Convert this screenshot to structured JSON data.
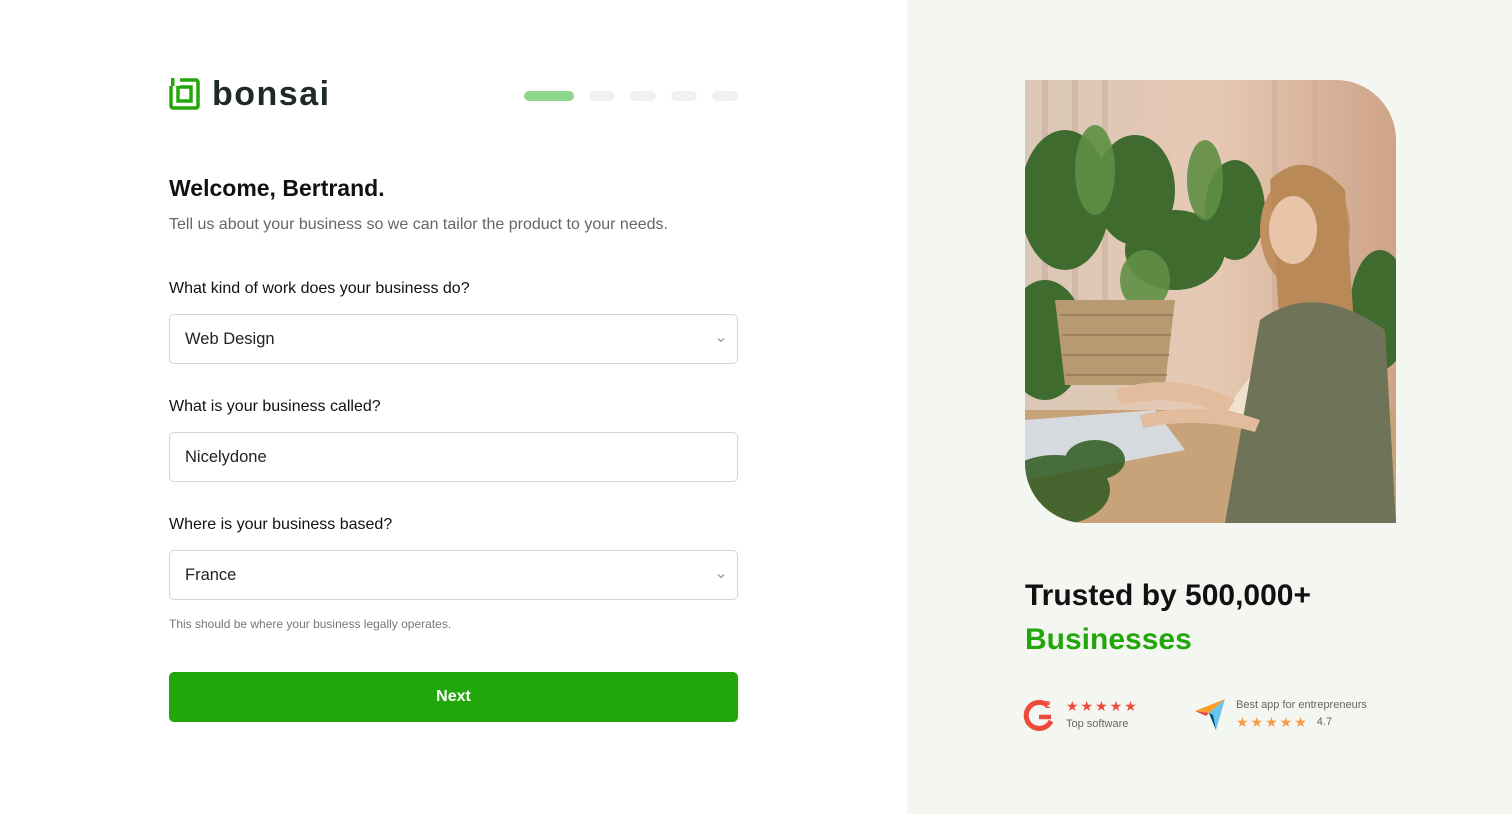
{
  "brand": {
    "name": "bonsai",
    "color": "#22a70b"
  },
  "progress": {
    "total_steps": 5,
    "current_step": 1
  },
  "header": {
    "title": "Welcome, Bertrand.",
    "subtitle": "Tell us about your business so we can tailor the product to your needs."
  },
  "form": {
    "work_type": {
      "label": "What kind of work does your business do?",
      "value": "Web Design"
    },
    "business_name": {
      "label": "What is your business called?",
      "value": "Nicelydone"
    },
    "location": {
      "label": "Where is your business based?",
      "value": "France",
      "hint": "This should be where your business legally operates."
    },
    "next_label": "Next"
  },
  "promo": {
    "trusted_line1": "Trusted by 500,000+",
    "trusted_line2": "Businesses",
    "g2": {
      "stars": "★★★★★",
      "caption": "Top software"
    },
    "capterra": {
      "caption": "Best app for entrepreneurs",
      "stars": "★★★★★",
      "rating": "4.7"
    }
  }
}
